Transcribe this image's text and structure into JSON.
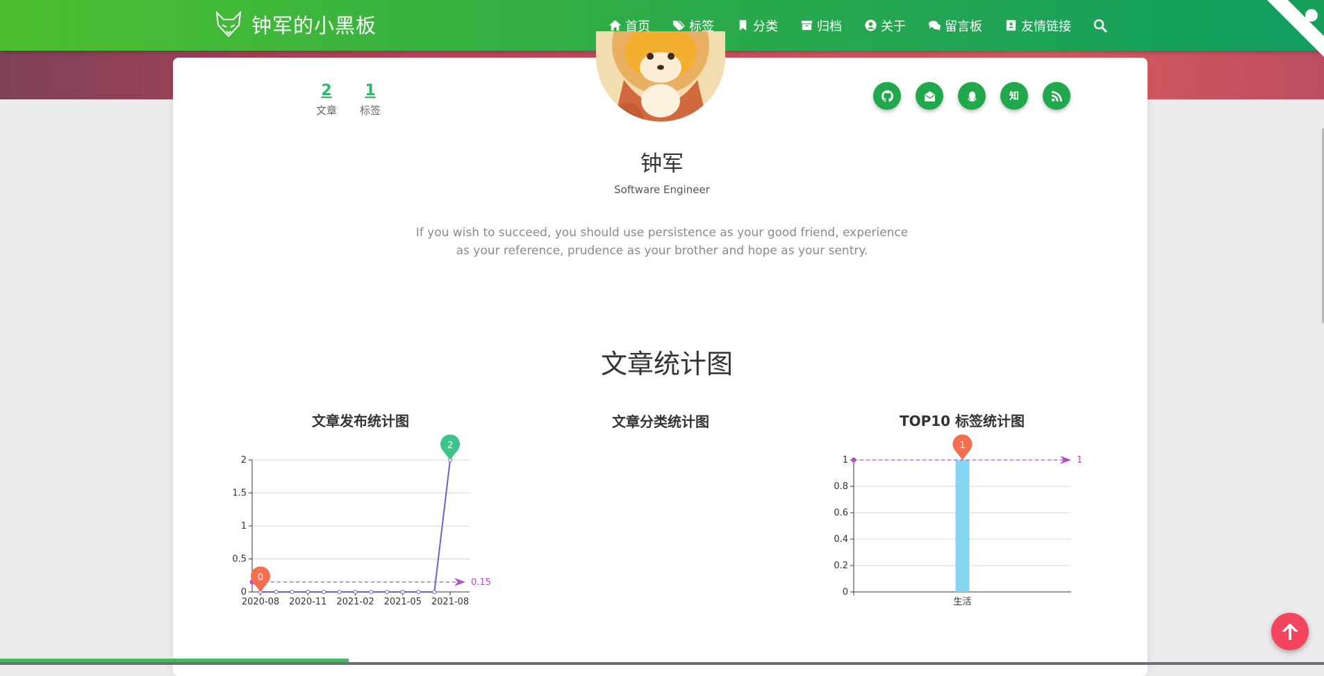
{
  "site": {
    "name": "钟军的小黑板"
  },
  "nav": {
    "items": [
      {
        "icon": "home-icon",
        "label": "首页"
      },
      {
        "icon": "tags-icon",
        "label": "标签"
      },
      {
        "icon": "bookmark-icon",
        "label": "分类"
      },
      {
        "icon": "archive-icon",
        "label": "归档"
      },
      {
        "icon": "user-circle-icon",
        "label": "关于"
      },
      {
        "icon": "comments-icon",
        "label": "留言板"
      },
      {
        "icon": "address-card-icon",
        "label": "友情链接"
      }
    ],
    "search_icon": "search-icon"
  },
  "stats": {
    "articles": {
      "value": "2",
      "label": "文章"
    },
    "tags": {
      "value": "1",
      "label": "标签"
    }
  },
  "socials": [
    {
      "icon": "github-icon",
      "text": ""
    },
    {
      "icon": "mail-icon",
      "text": ""
    },
    {
      "icon": "qq-icon",
      "text": ""
    },
    {
      "icon": "zhihu-icon",
      "text": "知"
    },
    {
      "icon": "rss-icon",
      "text": ""
    }
  ],
  "profile": {
    "name": "钟军",
    "job": "Software Engineer",
    "quote": "If you wish to succeed, you should use persistence as your good friend, experience as your reference, prudence as your brother and hope as your sentry."
  },
  "section_title": "文章统计图",
  "colors": {
    "nav_start": "#4cbf30",
    "nav_end": "#109d60",
    "accent": "#21a84c",
    "line": "#6b5fd9",
    "bar": "#87d3f2",
    "pin_max": "#3ec38a",
    "pin_min": "#f46f4f",
    "mark_line": "#b94bc9",
    "back_top": "#f4455f"
  },
  "chart_data": [
    {
      "type": "line",
      "title": "文章发布统计图",
      "x_labels": [
        "2020-08",
        "2020-11",
        "2021-02",
        "2021-05",
        "2021-08"
      ],
      "x": [
        "2020-08",
        "2020-09",
        "2020-10",
        "2020-11",
        "2020-12",
        "2021-01",
        "2021-02",
        "2021-03",
        "2021-04",
        "2021-05",
        "2021-06",
        "2021-07",
        "2021-08"
      ],
      "values": [
        0,
        0,
        0,
        0,
        0,
        0,
        0,
        0,
        0,
        0,
        0,
        0,
        2
      ],
      "yticks": [
        "0",
        "0.5",
        "1",
        "1.5",
        "2"
      ],
      "ylim": [
        0,
        2
      ],
      "max_point": {
        "label": "2",
        "value": 2
      },
      "min_point": {
        "label": "0",
        "value": 0
      },
      "average": {
        "label": "0.15",
        "value": 0.15
      },
      "grid": true
    },
    {
      "type": "pie",
      "title": "文章分类统计图",
      "values": []
    },
    {
      "type": "bar",
      "title": "TOP10 标签统计图",
      "categories": [
        "生活"
      ],
      "values": [
        1
      ],
      "yticks": [
        "0",
        "0.2",
        "0.4",
        "0.6",
        "0.8",
        "1"
      ],
      "ylim": [
        0,
        1
      ],
      "max_point": {
        "label": "1",
        "value": 1
      },
      "average": {
        "label": "1",
        "value": 1
      },
      "grid": true
    }
  ]
}
